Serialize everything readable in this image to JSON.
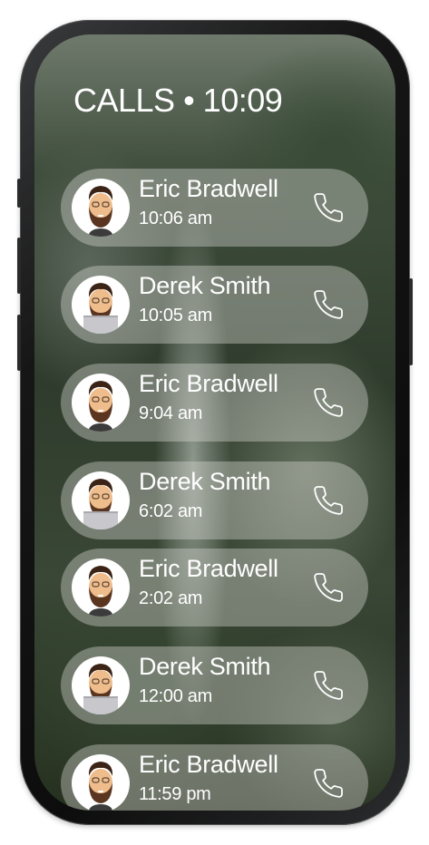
{
  "screen": {
    "title": "CALLS • 10:09"
  },
  "calls": [
    {
      "name": "Eric Bradwell",
      "time": "10:06 am",
      "avatar": "man-avatar"
    },
    {
      "name": "Derek Smith",
      "time": "10:05 am",
      "avatar": "man-laptop-avatar"
    },
    {
      "name": "Eric Bradwell",
      "time": "9:04 am",
      "avatar": "man-avatar"
    },
    {
      "name": "Derek Smith",
      "time": "6:02 am",
      "avatar": "man-laptop-avatar"
    },
    {
      "name": "Eric Bradwell",
      "time": "2:02 am",
      "avatar": "man-avatar"
    },
    {
      "name": "Derek Smith",
      "time": "12:00 am",
      "avatar": "man-laptop-avatar"
    },
    {
      "name": "Eric Bradwell",
      "time": "11:59 pm",
      "avatar": "man-avatar"
    }
  ],
  "icons": {
    "call": "phone-icon"
  }
}
